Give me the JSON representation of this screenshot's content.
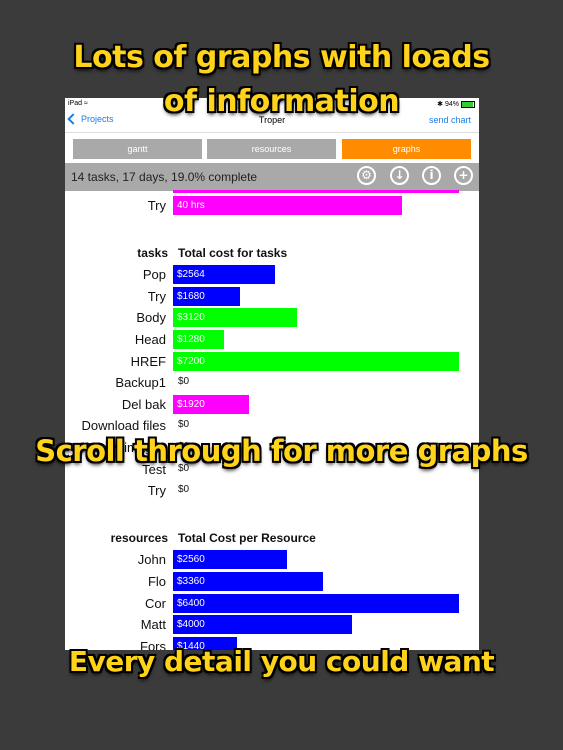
{
  "promo": {
    "line1": "Lots of graphs with loads",
    "line2": "of information",
    "line3": "Scroll through for more graphs",
    "line4": "Every detail you could want"
  },
  "status": {
    "device": "iPad",
    "battery": "94%"
  },
  "nav": {
    "back_label": "Projects",
    "title": "Troper",
    "right_label": "send chart"
  },
  "segments": [
    "gantt",
    "resources",
    "graphs"
  ],
  "selected_segment": "graphs",
  "toolbar": {
    "summary": "14 tasks, 17 days, 19.0% complete"
  },
  "colors": {
    "blue": "#0000ff",
    "green": "#00ff00",
    "magenta": "#ff00ff",
    "accent": "#ff8c00"
  },
  "chart_data": [
    {
      "type": "bar",
      "categories": [
        "Try"
      ],
      "values": [
        40
      ],
      "labels": [
        "40 hrs"
      ],
      "colors": [
        "#ff00ff"
      ]
    },
    {
      "type": "bar",
      "title": "Total cost for tasks",
      "ylabel": "tasks",
      "categories": [
        "Pop",
        "Try",
        "Body",
        "Head",
        "HREF",
        "Backup1",
        "Del bak",
        "Download files",
        "Screw images",
        "Test",
        "Try"
      ],
      "values": [
        2564,
        1680,
        3120,
        1280,
        7200,
        0,
        1920,
        0,
        0,
        0,
        0
      ],
      "labels": [
        "$2564",
        "$1680",
        "$3120",
        "$1280",
        "$7200",
        "$0",
        "$1920",
        "$0",
        "$0",
        "$0",
        "$0"
      ],
      "colors": [
        "#0000ff",
        "#0000ff",
        "#00ff00",
        "#00ff00",
        "#00ff00",
        "#0000ff",
        "#ff00ff",
        "#0000ff",
        "#0000ff",
        "#0000ff",
        "#0000ff"
      ],
      "xlim": [
        0,
        7200
      ]
    },
    {
      "type": "bar",
      "title": "Total Cost per Resource",
      "ylabel": "resources",
      "categories": [
        "John",
        "Flo",
        "Cor",
        "Matt",
        "Fors"
      ],
      "values": [
        2560,
        3360,
        6400,
        4000,
        1440
      ],
      "labels": [
        "$2560",
        "$3360",
        "$6400",
        "$4000",
        "$1440"
      ],
      "colors": [
        "#0000ff",
        "#0000ff",
        "#0000ff",
        "#0000ff",
        "#0000ff"
      ],
      "xlim": [
        0,
        6400
      ]
    }
  ]
}
